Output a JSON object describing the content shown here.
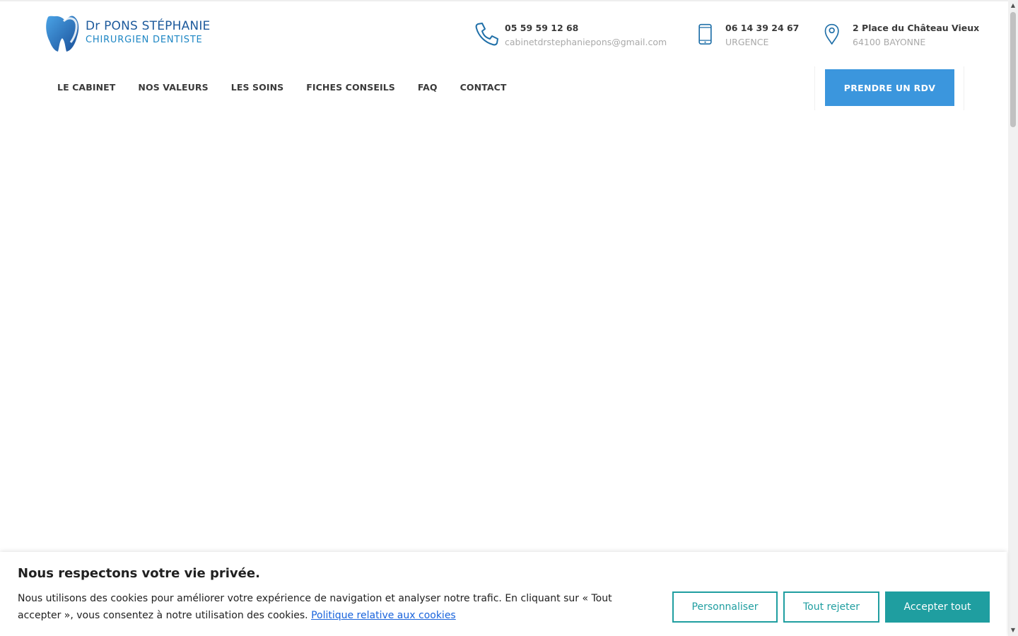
{
  "brand": {
    "name": "Dr PONS STÉPHANIE",
    "subtitle": "CHIRURGIEN DENTISTE",
    "colors": {
      "primary": "#1d5a9c",
      "accent": "#3b96dd",
      "teal": "#1f9ea0"
    }
  },
  "contacts": {
    "phone": {
      "icon": "phone-icon",
      "title": "05 59 59 12 68",
      "sub": "cabinetdrstephaniepons@gmail.com"
    },
    "mobile": {
      "icon": "mobile-phone-icon",
      "title": "06 14 39 24 67",
      "sub": "URGENCE"
    },
    "address": {
      "icon": "map-pin-icon",
      "title": "2 Place du Château Vieux",
      "sub": "64100 BAYONNE"
    }
  },
  "nav": {
    "items": [
      "LE CABINET",
      "NOS VALEURS",
      "LES SOINS",
      "FICHES CONSEILS",
      "FAQ",
      "CONTACT"
    ],
    "cta_label": "PRENDRE UN RDV"
  },
  "cookie": {
    "title": "Nous respectons votre vie privée.",
    "text": "Nous utilisons des cookies pour améliorer votre expérience de navigation et analyser notre trafic. En cliquant sur « Tout accepter », vous consentez à notre utilisation des cookies.",
    "link_label": "Politique relative aux cookies",
    "customize_label": "Personnaliser",
    "reject_label": "Tout rejeter",
    "accept_label": "Accepter tout"
  }
}
